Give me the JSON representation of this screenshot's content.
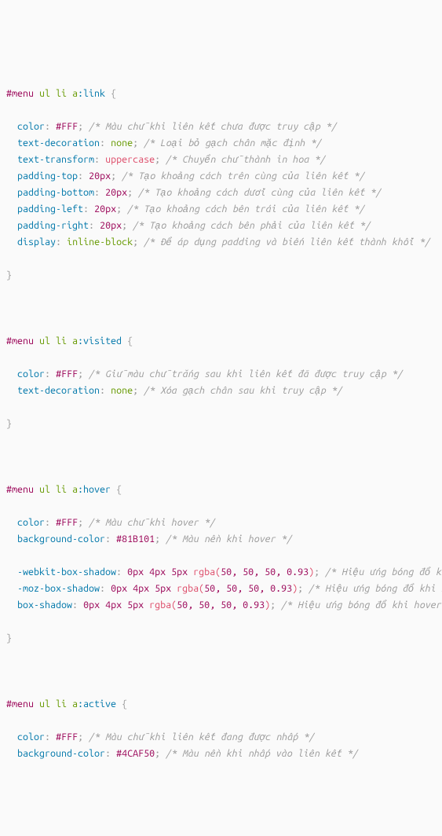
{
  "rule1": {
    "sel_id": "#menu",
    "sel_rest": " ul li a",
    "pseudo": ":link",
    "decls": [
      {
        "prop": "color",
        "valHex": "#FFF",
        "comment": "/* Màu chữ khi liên kết chưa được truy cập */"
      },
      {
        "prop": "text-decoration",
        "valKw": "none",
        "comment": "/* Loại bỏ gạch chân mặc định */"
      },
      {
        "prop": "text-transform",
        "valFn": "uppercase",
        "comment": "/* Chuyển chữ thành in hoa */"
      },
      {
        "prop": "padding-top",
        "valNum": "20px",
        "comment": "/* Tạo khoảng cách trên cùng của liên kết */"
      },
      {
        "prop": "padding-bottom",
        "valNum": "20px",
        "comment": "/* Tạo khoảng cách dưới cùng của liên kết */"
      },
      {
        "prop": "padding-left",
        "valNum": "20px",
        "comment": "/* Tạo khoảng cách bên trái của liên kết */"
      },
      {
        "prop": "padding-right",
        "valNum": "20px",
        "comment": "/* Tạo khoảng cách bên phải của liên kết */"
      },
      {
        "prop": "display",
        "valKw": "inline-block",
        "comment": "/* Để áp dụng padding và biến liên kết thành khối */"
      }
    ]
  },
  "rule2": {
    "sel_id": "#menu",
    "sel_rest": " ul li a",
    "pseudo": ":visited",
    "decls": [
      {
        "prop": "color",
        "valHex": "#FFF",
        "comment": "/* Giữ màu chữ trắng sau khi liên kết đã được truy cập */"
      },
      {
        "prop": "text-decoration",
        "valKw": "none",
        "comment": "/* Xóa gạch chân sau khi truy cập */"
      }
    ]
  },
  "rule3": {
    "sel_id": "#menu",
    "sel_rest": " ul li a",
    "pseudo": ":hover",
    "decls": [
      {
        "prop": "color",
        "valHex": "#FFF",
        "comment": "/* Màu chữ khi hover */"
      },
      {
        "prop": "background-color",
        "valHex": "#81B101",
        "comment": "/* Màu nền khi hover */"
      }
    ],
    "shadows": [
      {
        "prop": "-webkit-box-shadow",
        "nums": "0px 4px 5px ",
        "fn": "rgba(",
        "args": "50, 50, 50, 0.93",
        "close": ")",
        "comment": "/* Hiệu ứng bóng đổ khi hover (W"
      },
      {
        "prop": "-moz-box-shadow",
        "nums": "0px 4px 5px ",
        "fn": "rgba(",
        "args": "50, 50, 50, 0.93",
        "close": ")",
        "comment": "/* Hiệu ứng bóng đổ khi hover (Fire"
      },
      {
        "prop": "box-shadow",
        "nums": "0px 4px 5px ",
        "fn": "rgba(",
        "args": "50, 50, 50, 0.93",
        "close": ")",
        "comment": "/* Hiệu ứng bóng đổ khi hover (chuẩn) */"
      }
    ]
  },
  "rule4": {
    "sel_id": "#menu",
    "sel_rest": " ul li a",
    "pseudo": ":active",
    "decls": [
      {
        "prop": "color",
        "valHex": "#FFF",
        "comment": "/* Màu chữ khi liên kết đang được nhấp */"
      },
      {
        "prop": "background-color",
        "valHex": "#4CAF50",
        "comment": "/* Màu nền khi nhấp vào liên kết */"
      }
    ]
  }
}
